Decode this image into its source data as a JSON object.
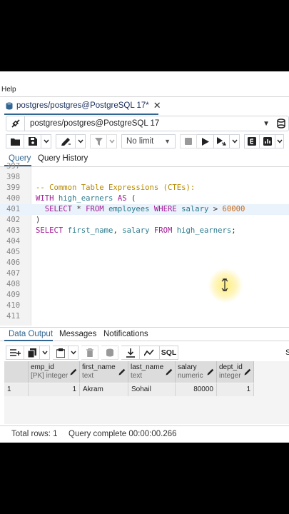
{
  "menu": {
    "help_label": "Help"
  },
  "query_tab": {
    "title": "postgres/postgres@PostgreSQL 17*",
    "close_symbol": "✕"
  },
  "connection": {
    "label": "postgres/postgres@PostgreSQL 17"
  },
  "toolbar": {
    "row_limit": "No limit"
  },
  "editor_tabs": {
    "query": "Query",
    "history": "Query History"
  },
  "editor": {
    "lines": [
      {
        "num": "397",
        "segments": []
      },
      {
        "num": "398",
        "segments": []
      },
      {
        "num": "399",
        "segments": [
          {
            "text": "-- Common Table Expressions (CTEs):",
            "cls": "c-cm"
          }
        ]
      },
      {
        "num": "400",
        "segments": [
          {
            "text": "WITH ",
            "cls": "c-kw"
          },
          {
            "text": "high_earners ",
            "cls": "c-id"
          },
          {
            "text": "AS ",
            "cls": "c-kw"
          },
          {
            "text": "(",
            "cls": "c-op"
          }
        ]
      },
      {
        "num": "401",
        "highlight": true,
        "segments": [
          {
            "text": "  SELECT ",
            "cls": "c-kw"
          },
          {
            "text": "* ",
            "cls": "c-op"
          },
          {
            "text": "FROM ",
            "cls": "c-kw"
          },
          {
            "text": "employees ",
            "cls": "c-id"
          },
          {
            "text": "WHERE ",
            "cls": "c-kw"
          },
          {
            "text": "salary ",
            "cls": "c-id"
          },
          {
            "text": "> ",
            "cls": "c-op"
          },
          {
            "text": "60000",
            "cls": "c-num"
          }
        ]
      },
      {
        "num": "402",
        "segments": [
          {
            "text": ")",
            "cls": "c-op"
          }
        ]
      },
      {
        "num": "403",
        "segments": [
          {
            "text": "SELECT ",
            "cls": "c-kw"
          },
          {
            "text": "first_name",
            "cls": "c-id"
          },
          {
            "text": ", ",
            "cls": "c-op"
          },
          {
            "text": "salary ",
            "cls": "c-id"
          },
          {
            "text": "FROM ",
            "cls": "c-kw"
          },
          {
            "text": "high_earners",
            "cls": "c-id"
          },
          {
            "text": ";",
            "cls": "c-op"
          }
        ]
      },
      {
        "num": "404",
        "segments": []
      },
      {
        "num": "405",
        "segments": []
      },
      {
        "num": "406",
        "segments": []
      },
      {
        "num": "407",
        "segments": []
      },
      {
        "num": "408",
        "segments": []
      },
      {
        "num": "409",
        "segments": []
      },
      {
        "num": "410",
        "segments": []
      },
      {
        "num": "411",
        "segments": []
      }
    ]
  },
  "output_tabs": {
    "data_output": "Data Output",
    "messages": "Messages",
    "notifications": "Notifications"
  },
  "grid_toolbar": {
    "sql_label": "SQL",
    "cut_letter": "S"
  },
  "result": {
    "columns": [
      {
        "name": "emp_id",
        "type": "[PK] integer"
      },
      {
        "name": "first_name",
        "type": "text"
      },
      {
        "name": "last_name",
        "type": "text"
      },
      {
        "name": "salary",
        "type": "numeric"
      },
      {
        "name": "dept_id",
        "type": "integer"
      }
    ],
    "rows": [
      {
        "rownum": "1",
        "cells": [
          "1",
          "Akram",
          "Sohail",
          "80000",
          "1"
        ]
      }
    ]
  },
  "status": {
    "total_rows": "Total rows: 1",
    "query_complete": "Query complete 00:00:00.266"
  },
  "colors": {
    "accent": "#326690",
    "keyword": "#a21b97",
    "identifier": "#2a7a8c",
    "comment": "#b58900",
    "number": "#c96b1a"
  }
}
